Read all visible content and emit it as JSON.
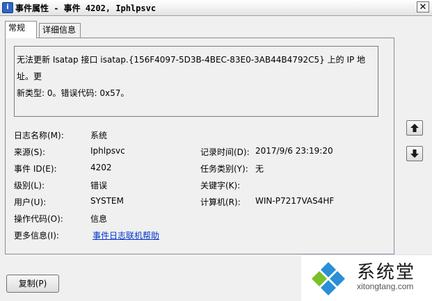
{
  "window": {
    "title": "事件属性 - 事件 4202, Iphlpsvc",
    "close_glyph": "✕"
  },
  "tabs": [
    {
      "label": "常规",
      "active": true
    },
    {
      "label": "详细信息",
      "active": false
    }
  ],
  "description": {
    "line1": "无法更新 Isatap 接口 isatap.{156F4097-5D3B-4BEC-83E0-3AB44B4792C5} 上的 IP 地址。更",
    "line2": "新类型: 0。错误代码: 0x57。"
  },
  "fields": {
    "log_name_label": "日志名称(M):",
    "log_name_value": "系统",
    "source_label": "来源(S):",
    "source_value": "Iphlpsvc",
    "logged_label": "记录时间(D):",
    "logged_value": "2017/9/6 23:19:20",
    "event_id_label": "事件 ID(E):",
    "event_id_value": "4202",
    "task_category_label": "任务类别(Y):",
    "task_category_value": "无",
    "level_label": "级别(L):",
    "level_value": "错误",
    "keywords_label": "关键字(K):",
    "keywords_value": "",
    "user_label": "用户(U):",
    "user_value": "SYSTEM",
    "computer_label": "计算机(R):",
    "computer_value": "WIN-P7217VAS4HF",
    "opcode_label": "操作代码(O):",
    "opcode_value": "信息",
    "more_info_label": "更多信息(I):",
    "more_info_link": "事件日志联机帮助"
  },
  "buttons": {
    "copy_label": "复制(P)"
  },
  "watermark": {
    "title": "系统堂",
    "url": "xitongtang.com"
  },
  "colors": {
    "link": "#0033cc",
    "logo_blue": "#2a8fd6",
    "logo_green": "#7bbf2a"
  },
  "icons": {
    "window": "event-viewer-icon",
    "close": "close-icon",
    "up": "arrow-up-icon",
    "down": "arrow-down-icon",
    "logo": "windows-logo-icon"
  }
}
